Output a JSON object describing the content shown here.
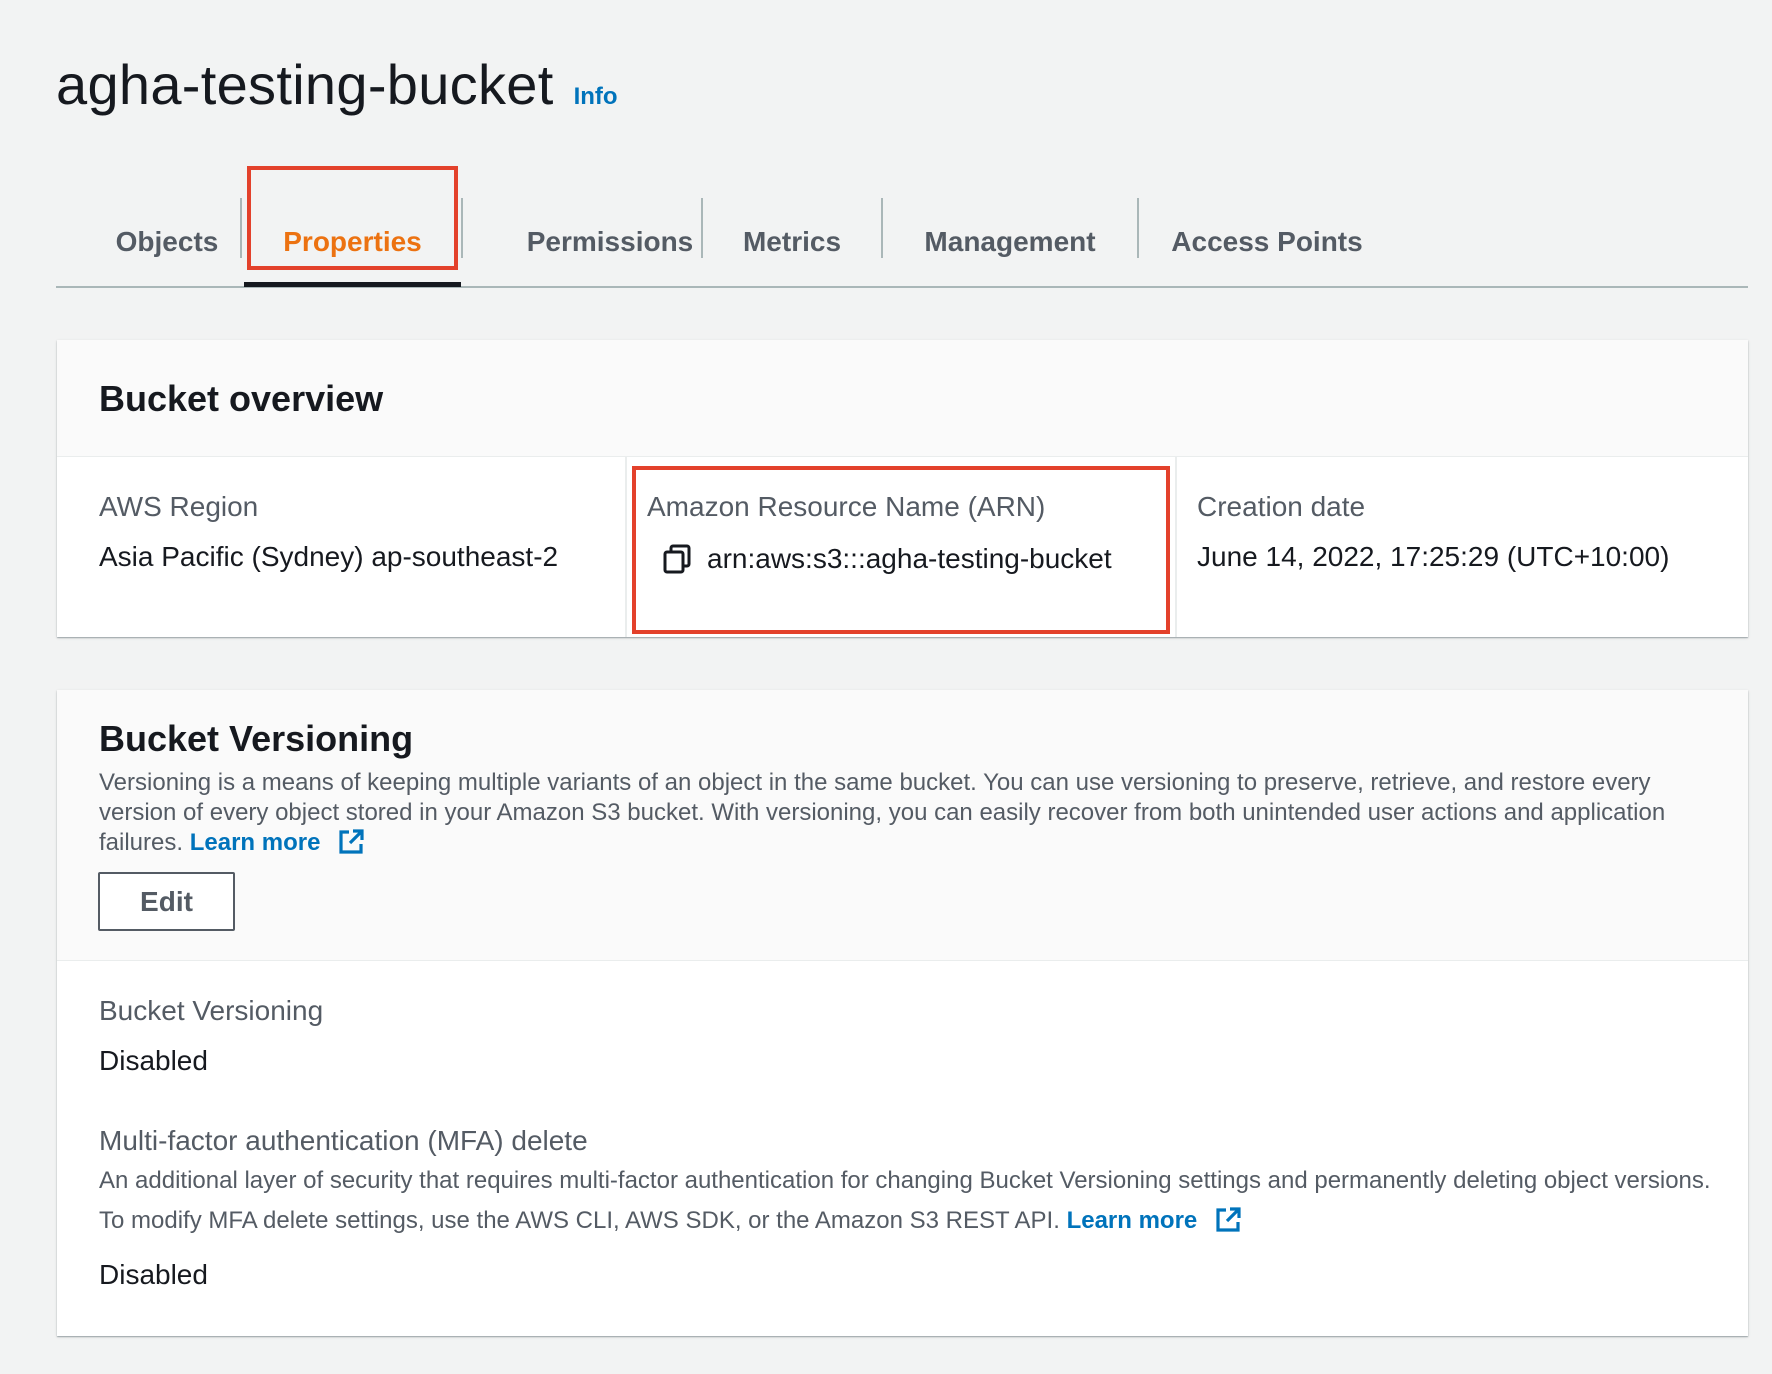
{
  "header": {
    "title": "agha-testing-bucket",
    "info_label": "Info"
  },
  "tabs": [
    {
      "label": "Objects",
      "active": false
    },
    {
      "label": "Properties",
      "active": true
    },
    {
      "label": "Permissions",
      "active": false
    },
    {
      "label": "Metrics",
      "active": false
    },
    {
      "label": "Management",
      "active": false
    },
    {
      "label": "Access Points",
      "active": false
    }
  ],
  "overview": {
    "title": "Bucket overview",
    "region_label": "AWS Region",
    "region_value": "Asia Pacific (Sydney) ap-southeast-2",
    "arn_label": "Amazon Resource Name (ARN)",
    "arn_value": "arn:aws:s3:::agha-testing-bucket",
    "created_label": "Creation date",
    "created_value": "June 14, 2022, 17:25:29 (UTC+10:00)"
  },
  "versioning": {
    "title": "Bucket Versioning",
    "description": "Versioning is a means of keeping multiple variants of an object in the same bucket. You can use versioning to preserve, retrieve, and restore every version of every object stored in your Amazon S3 bucket. With versioning, you can easily recover from both unintended user actions and application failures.",
    "learn_more": "Learn more",
    "edit_label": "Edit",
    "status_label": "Bucket Versioning",
    "status_value": "Disabled",
    "mfa_label": "Multi-factor authentication (MFA) delete",
    "mfa_description": "An additional layer of security that requires multi-factor authentication for changing Bucket Versioning settings and permanently deleting object versions. To modify MFA delete settings, use the AWS CLI, AWS SDK, or the Amazon S3 REST API.",
    "mfa_learn_more": "Learn more",
    "mfa_value": "Disabled"
  },
  "colors": {
    "accent": "#ec7211",
    "link": "#0073bb",
    "highlight": "#e3412b"
  },
  "icons": {
    "copy": "copy-icon",
    "external": "external-link-icon"
  }
}
